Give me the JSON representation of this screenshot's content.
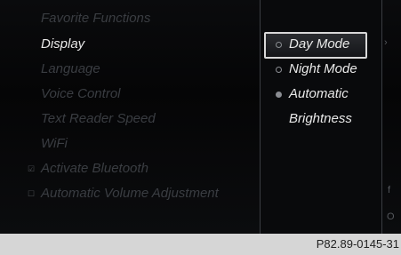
{
  "menu": {
    "items": [
      {
        "label": "Favorite Functions",
        "active": false
      },
      {
        "label": "Display",
        "active": true
      },
      {
        "label": "Language",
        "active": false
      },
      {
        "label": "Voice Control",
        "active": false
      },
      {
        "label": "Text Reader Speed",
        "active": false
      },
      {
        "label": "WiFi",
        "active": false
      },
      {
        "label": "Activate Bluetooth",
        "active": false,
        "checkbox": "checked"
      },
      {
        "label": "Automatic Volume Adjustment",
        "active": false,
        "checkbox": "unchecked"
      }
    ]
  },
  "submenu": {
    "options": [
      {
        "label": "Day Mode",
        "radio": "empty",
        "selected": true
      },
      {
        "label": "Night Mode",
        "radio": "empty"
      },
      {
        "label": "Automatic",
        "radio": "filled"
      },
      {
        "label": "Brightness"
      }
    ]
  },
  "edge_glyphs": {
    "top": "›",
    "middle": "f",
    "bottom": "O"
  },
  "footer": {
    "reference": "P82.89-0145-31"
  },
  "colors": {
    "active_text": "#e8e8e8",
    "inactive_text": "#3a3d42",
    "footer_bg": "#d6d6d6"
  }
}
